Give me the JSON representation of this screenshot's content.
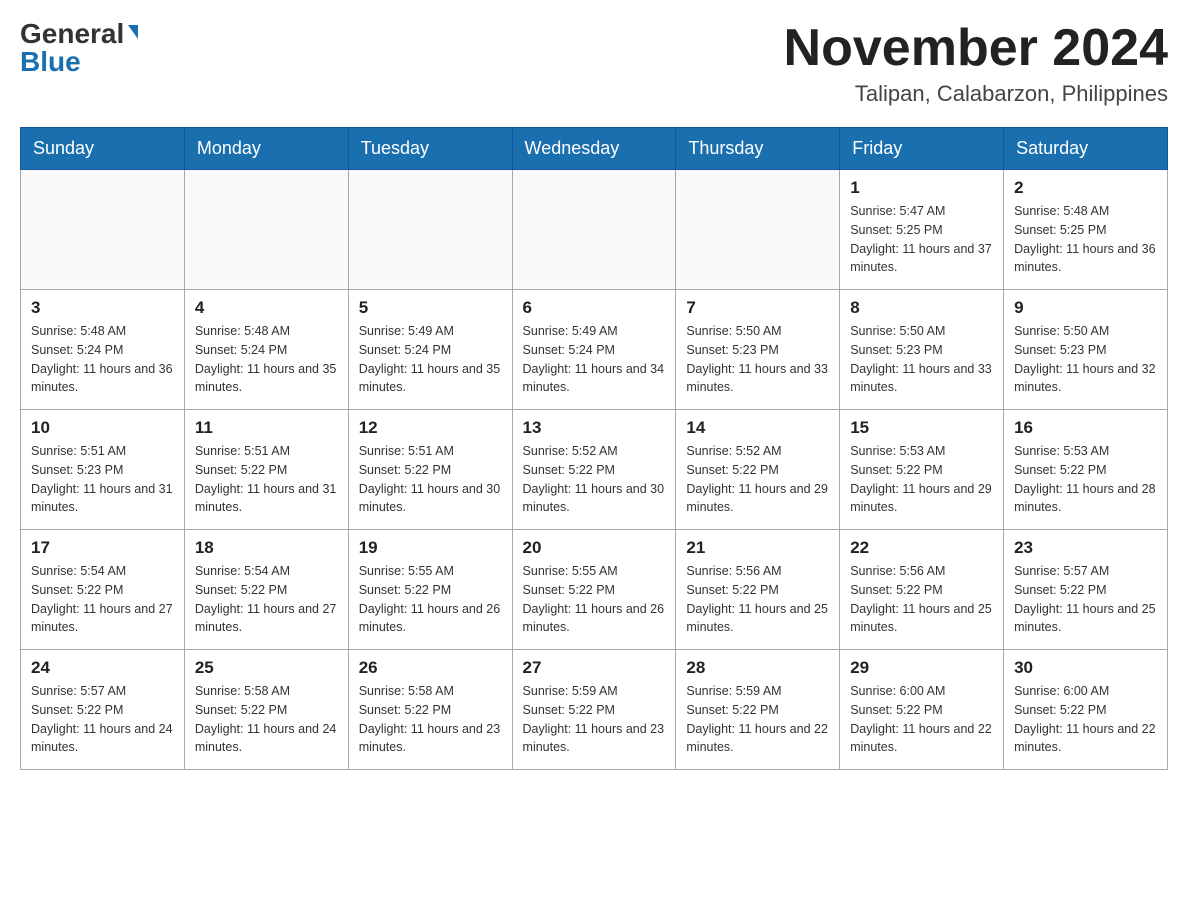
{
  "header": {
    "logo_general": "General",
    "logo_blue": "Blue",
    "month_title": "November 2024",
    "location": "Talipan, Calabarzon, Philippines"
  },
  "days_of_week": [
    "Sunday",
    "Monday",
    "Tuesday",
    "Wednesday",
    "Thursday",
    "Friday",
    "Saturday"
  ],
  "weeks": [
    [
      {
        "day": "",
        "info": ""
      },
      {
        "day": "",
        "info": ""
      },
      {
        "day": "",
        "info": ""
      },
      {
        "day": "",
        "info": ""
      },
      {
        "day": "",
        "info": ""
      },
      {
        "day": "1",
        "info": "Sunrise: 5:47 AM\nSunset: 5:25 PM\nDaylight: 11 hours and 37 minutes."
      },
      {
        "day": "2",
        "info": "Sunrise: 5:48 AM\nSunset: 5:25 PM\nDaylight: 11 hours and 36 minutes."
      }
    ],
    [
      {
        "day": "3",
        "info": "Sunrise: 5:48 AM\nSunset: 5:24 PM\nDaylight: 11 hours and 36 minutes."
      },
      {
        "day": "4",
        "info": "Sunrise: 5:48 AM\nSunset: 5:24 PM\nDaylight: 11 hours and 35 minutes."
      },
      {
        "day": "5",
        "info": "Sunrise: 5:49 AM\nSunset: 5:24 PM\nDaylight: 11 hours and 35 minutes."
      },
      {
        "day": "6",
        "info": "Sunrise: 5:49 AM\nSunset: 5:24 PM\nDaylight: 11 hours and 34 minutes."
      },
      {
        "day": "7",
        "info": "Sunrise: 5:50 AM\nSunset: 5:23 PM\nDaylight: 11 hours and 33 minutes."
      },
      {
        "day": "8",
        "info": "Sunrise: 5:50 AM\nSunset: 5:23 PM\nDaylight: 11 hours and 33 minutes."
      },
      {
        "day": "9",
        "info": "Sunrise: 5:50 AM\nSunset: 5:23 PM\nDaylight: 11 hours and 32 minutes."
      }
    ],
    [
      {
        "day": "10",
        "info": "Sunrise: 5:51 AM\nSunset: 5:23 PM\nDaylight: 11 hours and 31 minutes."
      },
      {
        "day": "11",
        "info": "Sunrise: 5:51 AM\nSunset: 5:22 PM\nDaylight: 11 hours and 31 minutes."
      },
      {
        "day": "12",
        "info": "Sunrise: 5:51 AM\nSunset: 5:22 PM\nDaylight: 11 hours and 30 minutes."
      },
      {
        "day": "13",
        "info": "Sunrise: 5:52 AM\nSunset: 5:22 PM\nDaylight: 11 hours and 30 minutes."
      },
      {
        "day": "14",
        "info": "Sunrise: 5:52 AM\nSunset: 5:22 PM\nDaylight: 11 hours and 29 minutes."
      },
      {
        "day": "15",
        "info": "Sunrise: 5:53 AM\nSunset: 5:22 PM\nDaylight: 11 hours and 29 minutes."
      },
      {
        "day": "16",
        "info": "Sunrise: 5:53 AM\nSunset: 5:22 PM\nDaylight: 11 hours and 28 minutes."
      }
    ],
    [
      {
        "day": "17",
        "info": "Sunrise: 5:54 AM\nSunset: 5:22 PM\nDaylight: 11 hours and 27 minutes."
      },
      {
        "day": "18",
        "info": "Sunrise: 5:54 AM\nSunset: 5:22 PM\nDaylight: 11 hours and 27 minutes."
      },
      {
        "day": "19",
        "info": "Sunrise: 5:55 AM\nSunset: 5:22 PM\nDaylight: 11 hours and 26 minutes."
      },
      {
        "day": "20",
        "info": "Sunrise: 5:55 AM\nSunset: 5:22 PM\nDaylight: 11 hours and 26 minutes."
      },
      {
        "day": "21",
        "info": "Sunrise: 5:56 AM\nSunset: 5:22 PM\nDaylight: 11 hours and 25 minutes."
      },
      {
        "day": "22",
        "info": "Sunrise: 5:56 AM\nSunset: 5:22 PM\nDaylight: 11 hours and 25 minutes."
      },
      {
        "day": "23",
        "info": "Sunrise: 5:57 AM\nSunset: 5:22 PM\nDaylight: 11 hours and 25 minutes."
      }
    ],
    [
      {
        "day": "24",
        "info": "Sunrise: 5:57 AM\nSunset: 5:22 PM\nDaylight: 11 hours and 24 minutes."
      },
      {
        "day": "25",
        "info": "Sunrise: 5:58 AM\nSunset: 5:22 PM\nDaylight: 11 hours and 24 minutes."
      },
      {
        "day": "26",
        "info": "Sunrise: 5:58 AM\nSunset: 5:22 PM\nDaylight: 11 hours and 23 minutes."
      },
      {
        "day": "27",
        "info": "Sunrise: 5:59 AM\nSunset: 5:22 PM\nDaylight: 11 hours and 23 minutes."
      },
      {
        "day": "28",
        "info": "Sunrise: 5:59 AM\nSunset: 5:22 PM\nDaylight: 11 hours and 22 minutes."
      },
      {
        "day": "29",
        "info": "Sunrise: 6:00 AM\nSunset: 5:22 PM\nDaylight: 11 hours and 22 minutes."
      },
      {
        "day": "30",
        "info": "Sunrise: 6:00 AM\nSunset: 5:22 PM\nDaylight: 11 hours and 22 minutes."
      }
    ]
  ]
}
